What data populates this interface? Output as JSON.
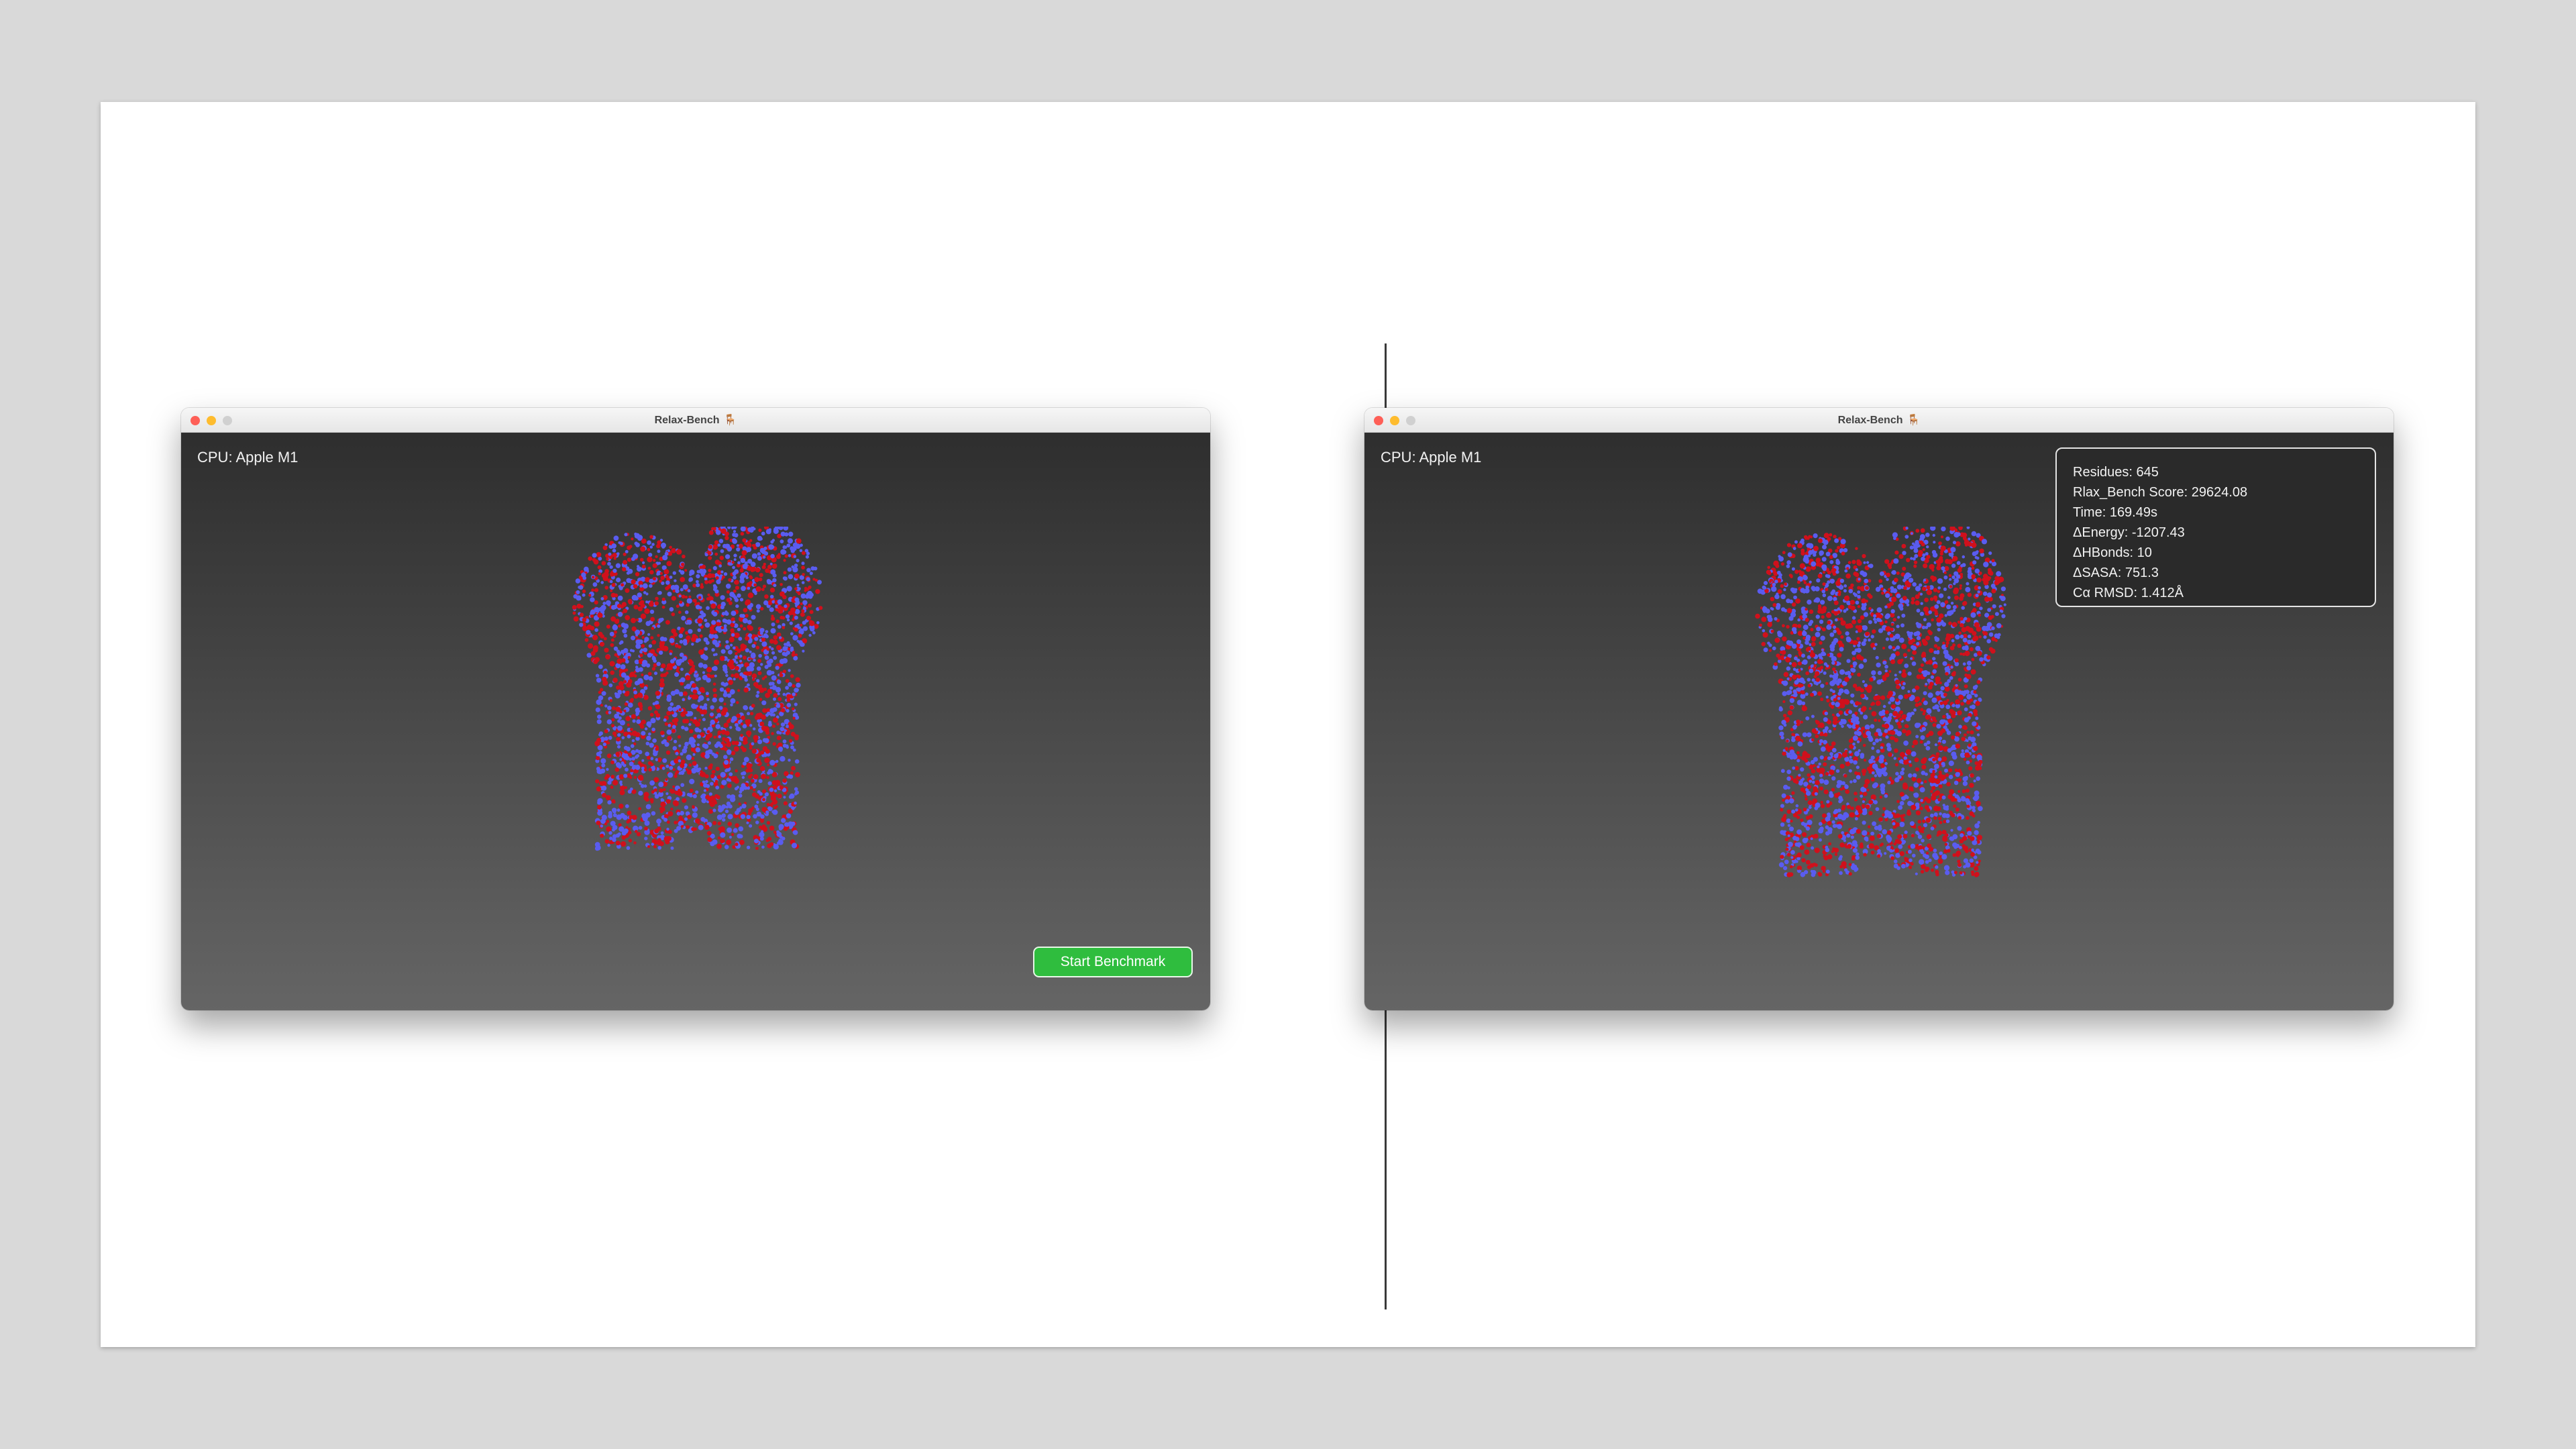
{
  "app": {
    "title": "Relax-Bench",
    "title_icon": "🪑"
  },
  "left_window": {
    "cpu_label": "CPU: Apple M1",
    "start_button_label": "Start Benchmark"
  },
  "right_window": {
    "cpu_label": "CPU: Apple M1",
    "stats": [
      "Residues: 645",
      "Rlax_Bench Score: 29624.08",
      "Time: 169.49s",
      "ΔEnergy: -1207.43",
      "ΔHBonds: 10",
      "ΔSASA: 751.3",
      "Cα RMSD: 1.412Å"
    ]
  },
  "colors": {
    "atom_red": "#d0101c",
    "atom_blue": "#5a5cf0",
    "button_green": "#2fbd3e",
    "background_top": "#2e2e2e",
    "background_bottom": "#656565"
  },
  "icons": [
    "close-light",
    "minimize-light",
    "maximize-light",
    "chair-icon"
  ]
}
